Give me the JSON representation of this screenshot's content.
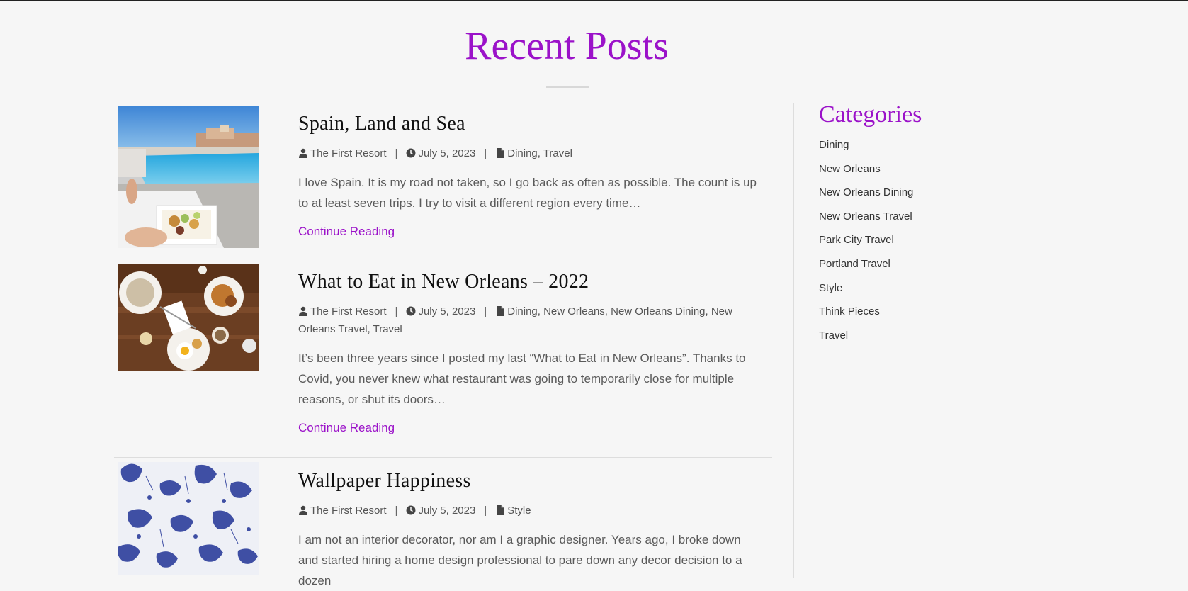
{
  "page": {
    "title": "Recent Posts"
  },
  "posts": [
    {
      "title": "Spain, Land and Sea",
      "author": "The First Resort",
      "date": "July 5, 2023",
      "categories": "Dining, Travel",
      "excerpt": "I love Spain.  It is my road not taken, so I go back as often as possible. The count is up to at least seven trips.  I try to visit a different region every time…",
      "continue_label": "Continue Reading",
      "meta_separator": "|"
    },
    {
      "title": "What to Eat in New Orleans – 2022",
      "author": "The First Resort",
      "date": "July 5, 2023",
      "categories": "Dining, New Orleans, New Orleans Dining, New Orleans Travel, Travel",
      "excerpt": "It’s been three years since I posted my last “What to Eat in New Orleans”.  Thanks to Covid, you never knew what restaurant was going to temporarily close for multiple reasons, or shut its doors…",
      "continue_label": "Continue Reading",
      "meta_separator": "|"
    },
    {
      "title": "Wallpaper Happiness",
      "author": "The First Resort",
      "date": "July 5, 2023",
      "categories": "Style",
      "excerpt": "I am not an interior decorator, nor am I a graphic designer.  Years ago, I broke down and started hiring a home design professional to pare down any decor decision to a dozen",
      "continue_label": "",
      "meta_separator": "|"
    }
  ],
  "sidebar": {
    "title": "Categories",
    "categories": [
      "Dining",
      "New Orleans",
      "New Orleans Dining",
      "New Orleans Travel",
      "Park City Travel",
      "Portland Travel",
      "Style",
      "Think Pieces",
      "Travel"
    ]
  },
  "icons": {
    "author": "user-icon",
    "date": "clock-icon",
    "category": "file-icon"
  },
  "colors": {
    "accent": "#9b12c9",
    "background": "#f6f6f6",
    "text": "#333333",
    "divider": "#dddddd"
  }
}
